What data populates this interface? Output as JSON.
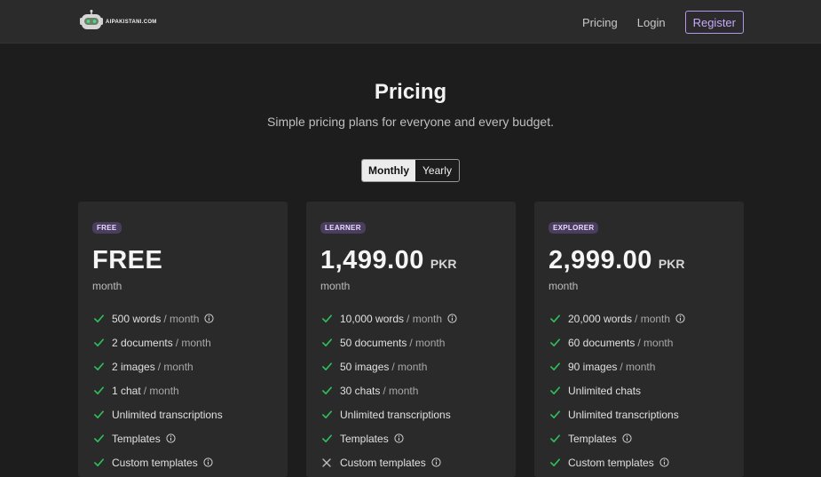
{
  "header": {
    "logo_text": "AIPAKISTANI.COM",
    "nav": [
      {
        "label": "Pricing"
      },
      {
        "label": "Login"
      }
    ],
    "register_label": "Register"
  },
  "hero": {
    "title": "Pricing",
    "subtitle": "Simple pricing plans for everyone and every budget."
  },
  "billing_toggle": {
    "monthly": "Monthly",
    "yearly": "Yearly",
    "selected": "Monthly"
  },
  "colors": {
    "accent": "#b497e8",
    "check": "#2fbf5a",
    "cross": "#bdbdbd",
    "card_bg": "#2a2a2a",
    "page_bg": "#1d1d1d"
  },
  "plans": [
    {
      "badge": "FREE",
      "price": "FREE",
      "currency": "",
      "period": "month",
      "features": [
        {
          "text": "500 words",
          "suffix": "/ month",
          "included": true,
          "info": true
        },
        {
          "text": "2 documents",
          "suffix": "/ month",
          "included": true,
          "info": false
        },
        {
          "text": "2 images",
          "suffix": "/ month",
          "included": true,
          "info": false
        },
        {
          "text": "1 chat",
          "suffix": "/ month",
          "included": true,
          "info": false
        },
        {
          "text": "Unlimited transcriptions",
          "suffix": "",
          "included": true,
          "info": false
        },
        {
          "text": "Templates",
          "suffix": "",
          "included": true,
          "info": true
        },
        {
          "text": "Custom templates",
          "suffix": "",
          "included": true,
          "info": true
        }
      ]
    },
    {
      "badge": "LEARNER",
      "price": "1,499.00",
      "currency": "PKR",
      "period": "month",
      "features": [
        {
          "text": "10,000 words",
          "suffix": "/ month",
          "included": true,
          "info": true
        },
        {
          "text": "50 documents",
          "suffix": "/ month",
          "included": true,
          "info": false
        },
        {
          "text": "50 images",
          "suffix": "/ month",
          "included": true,
          "info": false
        },
        {
          "text": "30 chats",
          "suffix": "/ month",
          "included": true,
          "info": false
        },
        {
          "text": "Unlimited transcriptions",
          "suffix": "",
          "included": true,
          "info": false
        },
        {
          "text": "Templates",
          "suffix": "",
          "included": true,
          "info": true
        },
        {
          "text": "Custom templates",
          "suffix": "",
          "included": false,
          "info": true
        }
      ]
    },
    {
      "badge": "EXPLORER",
      "price": "2,999.00",
      "currency": "PKR",
      "period": "month",
      "features": [
        {
          "text": "20,000 words",
          "suffix": "/ month",
          "included": true,
          "info": true
        },
        {
          "text": "60 documents",
          "suffix": "/ month",
          "included": true,
          "info": false
        },
        {
          "text": "90 images",
          "suffix": "/ month",
          "included": true,
          "info": false
        },
        {
          "text": "Unlimited chats",
          "suffix": "",
          "included": true,
          "info": false
        },
        {
          "text": "Unlimited transcriptions",
          "suffix": "",
          "included": true,
          "info": false
        },
        {
          "text": "Templates",
          "suffix": "",
          "included": true,
          "info": true
        },
        {
          "text": "Custom templates",
          "suffix": "",
          "included": true,
          "info": true
        }
      ]
    }
  ]
}
